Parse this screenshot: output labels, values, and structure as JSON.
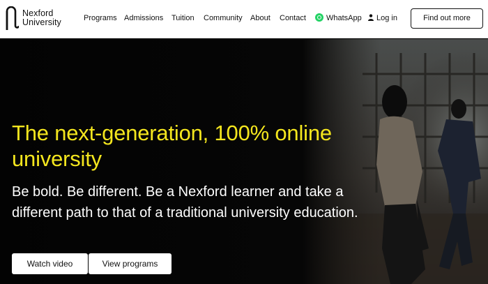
{
  "brand": {
    "name_line1": "Nexford",
    "name_line2": "University",
    "logo_icon": "nexford-n-logo"
  },
  "nav": {
    "items": [
      {
        "label": "Programs"
      },
      {
        "label": "Admissions"
      },
      {
        "label": "Tuition"
      },
      {
        "label": "Community"
      },
      {
        "label": "About"
      },
      {
        "label": "Contact"
      },
      {
        "label": "WhatsApp",
        "icon": "whatsapp-icon"
      },
      {
        "label": "Log in",
        "icon": "user-icon"
      }
    ],
    "cta_label": "Find out more"
  },
  "hero": {
    "title": "The next-generation, 100% online university",
    "subtitle": "Be bold. Be different. Be a Nexford learner and take a different path to that of a traditional university education.",
    "buttons": {
      "watch_video": "Watch video",
      "view_programs": "View programs"
    }
  },
  "colors": {
    "accent_yellow": "#f4e61e",
    "whatsapp_green": "#25d366",
    "hero_background": "#050505"
  }
}
